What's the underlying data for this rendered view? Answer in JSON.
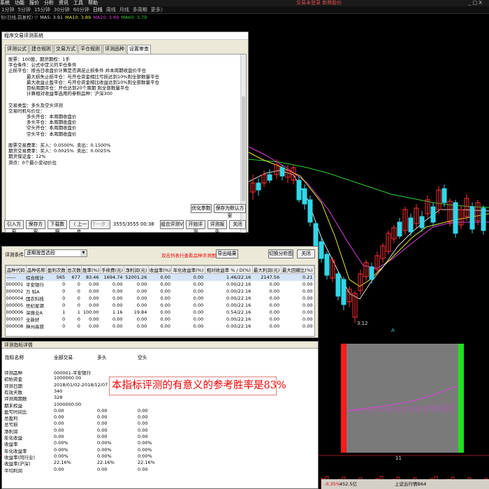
{
  "menubar": {
    "items": [
      "系统",
      "功能",
      "报价",
      "分析",
      "资讯",
      "工具",
      "帮助"
    ],
    "login": "交易未登录 新牌股价",
    "win_controls": "_ □ X"
  },
  "timeframes": {
    "items": [
      "1分钟",
      "5分钟",
      "15分钟",
      "30分钟",
      "60分钟",
      "日线",
      "周线",
      "月线",
      "多周期",
      "更多〉"
    ],
    "active_index": 5
  },
  "ma_legend": {
    "prefix": "份(日线,前复权) ▽",
    "items": [
      {
        "text": "MA5: 3.91",
        "color": "#dddddd"
      },
      {
        "text": "MA10: 3.89",
        "color": "#e8e83a"
      },
      {
        "text": "MA20: 3.89",
        "color": "#e040e0"
      },
      {
        "text": "MA60: 3.79",
        "color": "#30d030"
      }
    ]
  },
  "chart_labels": {
    "low": "3.12",
    "marker": "A",
    "cursor_label": "11"
  },
  "colors": {
    "up": "#ff3030",
    "down": "#31d7e8",
    "ma5": "#dddddd",
    "ma10": "#e8e83a",
    "ma20": "#e040e0",
    "ma60": "#30d030",
    "alert": "#ee0000"
  },
  "test_window": {
    "title": "程序交易评测系统",
    "tabs": [
      "评测公式",
      "建仓规则",
      "交易方式",
      "平仓规则",
      "评测品种",
      "设置审查"
    ],
    "active_tab": 5,
    "text_lines": [
      "股票：100股，期货期权：1手",
      "平仓条件：公式中定义的平仓条件",
      "止损平仓：按当日收盘价计算是否满足止损条件 并本周期收盘价平仓",
      "最大损失止损平仓：与开仓资金相比亏损达到10%则全部数量平仓",
      "最大收益止盈平仓：与开仓资金相比收益达到10%则全部数量平仓",
      "目标周期平仓：开仓达到20个周期 则全部数量平仓",
      "计算相对收益率选用的参照品种：沪深300",
      "",
      "交易类型：多头及空头评测",
      "交易时机与价位：",
      "多头开仓：本周期收盘价",
      "多头平仓：本周期收盘价",
      "空头开仓：本周期收盘价",
      "空头平仓：本周期收盘价",
      "",
      "股票交易费率：买入：0.0500%  卖出：0.1500%",
      "期货交易费率：买入：0.0025%  卖出：0.0025%",
      "期货保证金：12%",
      "滑点：0个最小变动价位"
    ],
    "btn_optimize": "优化参数",
    "btn_save_default": "保存为默认方案",
    "btn_import": "引入方案",
    "btn_save": "保存方案",
    "btn_download": "下载数据",
    "btn_prev": "〈 上一步",
    "btn_next": "下一步 〉",
    "step_value": "3555/3555 00:38",
    "btn_combo": "组合评测V",
    "btn_start": "开始评测",
    "btn_report": "评测报告",
    "btn_close": "关闭"
  },
  "result_window": {
    "cond_label": "评测条件：",
    "cond_value": "逐期按首选段",
    "hint": "双击列表行查看品种评测图表",
    "btn_export": "导出结果",
    "btn_switch": "切换分析图",
    "btn_close": "关闭",
    "columns": [
      "品种代码",
      "品种名称",
      "盈利次数",
      "总次数",
      "胜率(%)",
      "手续费(元)",
      "净利润(元)",
      "收益率(%)",
      "年化收益率(%)",
      "相对收益率 % / D(%)",
      "最大利润(元)",
      "最大回撤比(%)"
    ],
    "rows": [
      [
        "------",
        "综合统计",
        "565",
        "677",
        "83.46",
        "1694.74",
        "52001.26",
        "0.00",
        "0.00",
        "1.46/22.16",
        "2147.56",
        "0.21"
      ],
      [
        "000001",
        "平安银行",
        "0",
        "0",
        "0.00",
        "0.00",
        "0.00",
        "0.00",
        "0.00",
        "0.00/22.16",
        "0.00",
        "0.00"
      ],
      [
        "000002",
        "万 科A",
        "0",
        "0",
        "0.00",
        "0.00",
        "0.00",
        "0.00",
        "0.00",
        "0.00/22.16",
        "0.00",
        "0.00"
      ],
      [
        "000004",
        "国农科技",
        "0",
        "0",
        "0.00",
        "0.00",
        "0.00",
        "0.00",
        "0.00",
        "0.00/22.16",
        "0.00",
        "0.00"
      ],
      [
        "000005",
        "世纪星源",
        "0",
        "0",
        "0.00",
        "0.00",
        "0.00",
        "0.00",
        "0.00",
        "0.00/22.16",
        "0.00",
        "0.00"
      ],
      [
        "000006",
        "深振业A",
        "1",
        "1",
        "100.00",
        "1.16",
        "19.84",
        "0.00",
        "0.00",
        "0.54/22.16",
        "0.00",
        "0.00"
      ],
      [
        "000007",
        "全新好",
        "0",
        "0",
        "0.00",
        "0.00",
        "0.00",
        "0.00",
        "0.00",
        "0.00/22.16",
        "0.00",
        "0.00"
      ],
      [
        "000008",
        "神州高铁",
        "0",
        "0",
        "0.00",
        "0.00",
        "0.00",
        "0.00",
        "0.00",
        "0.00/22.16",
        "0.00",
        "0.00"
      ]
    ]
  },
  "detail_window": {
    "title": "评测指标详情",
    "headers": [
      "指标名称",
      "全部交易",
      "多头",
      "空头"
    ],
    "rows": [
      [
        "评测品种",
        "000001-平安银行",
        "",
        ""
      ],
      [
        "初始资金",
        "1000000.00",
        "",
        ""
      ],
      [
        "评测日期",
        "2018/01/02-2018/12/07",
        "",
        ""
      ],
      [
        "有效天数",
        "340",
        "",
        ""
      ],
      [
        "评测周期数",
        "328",
        "",
        ""
      ],
      [
        "期末权益",
        "1000000.00",
        "",
        ""
      ],
      [
        "盈亏时间比",
        "0.00",
        "0.00",
        "0.00"
      ],
      [
        "总盈利",
        "0.00",
        "0.00",
        "0.00"
      ],
      [
        "总亏损",
        "0.00",
        "0.00",
        "0.00"
      ],
      [
        "净利润",
        "0.00",
        "0.00",
        "0.00"
      ],
      [
        "年化收益",
        "0.00",
        "0.00",
        "0.00"
      ],
      [
        "收益率",
        "0.00%",
        "0.00%",
        "0.00%"
      ],
      [
        "年化收益率",
        "0.00%",
        "0.00%",
        "0.00%"
      ],
      [
        "收益率(同行业)",
        "0.00%",
        "0.00%",
        "0.00%"
      ],
      [
        "收益率(沪深)",
        "22.16%",
        "22.16%",
        "22.16%"
      ],
      [
        "平均利润",
        "0.00",
        "0.00",
        "0.00"
      ]
    ],
    "callout": "本指标评测的有意义的参考胜率是83%"
  },
  "status": {
    "pct": "-0.35%",
    "price": "452.5亿",
    "index": "上证云行情B64"
  }
}
